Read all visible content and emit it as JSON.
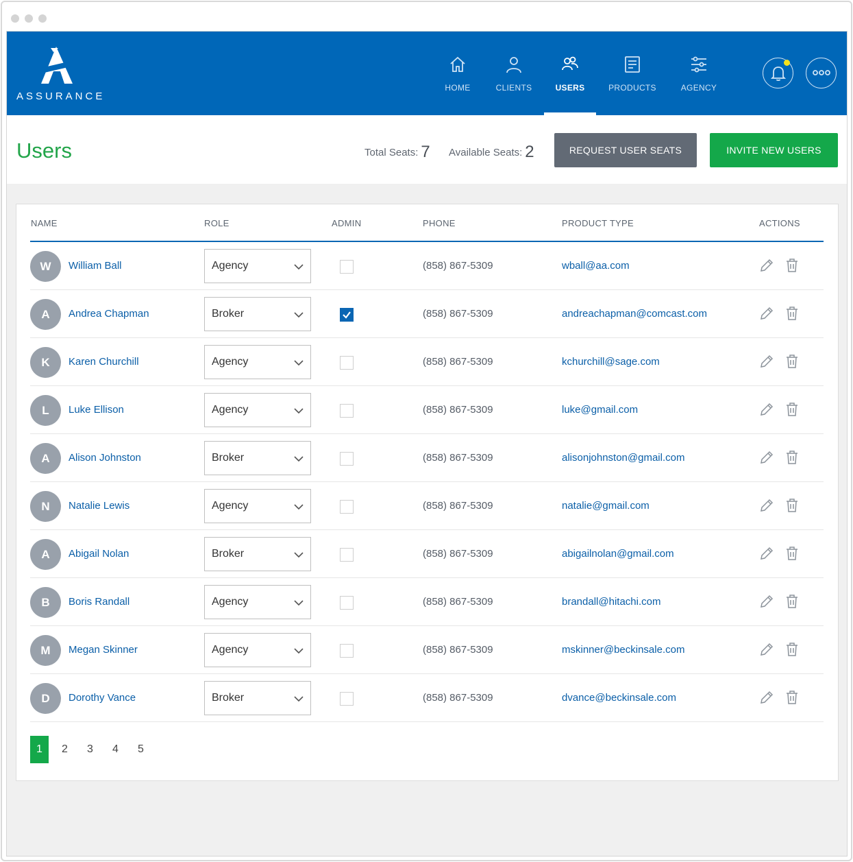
{
  "brand": {
    "name": "ASSURANCE"
  },
  "nav": [
    {
      "label": "HOME",
      "icon": "home-icon",
      "active": false
    },
    {
      "label": "CLIENTS",
      "icon": "user-icon",
      "active": false
    },
    {
      "label": "USERS",
      "icon": "users-icon",
      "active": true
    },
    {
      "label": "PRODUCTS",
      "icon": "document-icon",
      "active": false
    },
    {
      "label": "AGENCY",
      "icon": "sliders-icon",
      "active": false
    }
  ],
  "header_actions": {
    "notifications_icon": "bell-icon",
    "more_icon": "more-icon"
  },
  "page": {
    "title": "Users",
    "total_seats_label": "Total Seats:",
    "total_seats": "7",
    "available_seats_label": "Available Seats:",
    "available_seats": "2",
    "request_button": "REQUEST USER SEATS",
    "invite_button": "INVITE NEW USERS"
  },
  "table": {
    "columns": [
      "NAME",
      "ROLE",
      "ADMIN",
      "PHONE",
      "PRODUCT TYPE",
      "ACTIONS"
    ],
    "rows": [
      {
        "initial": "W",
        "name": "William Ball",
        "role": "Agency",
        "admin": false,
        "phone": "(858) 867-5309",
        "email": "wball@aa.com"
      },
      {
        "initial": "A",
        "name": "Andrea Chapman",
        "role": "Broker",
        "admin": true,
        "phone": "(858) 867-5309",
        "email": "andreachapman@comcast.com"
      },
      {
        "initial": "K",
        "name": "Karen Churchill",
        "role": "Agency",
        "admin": false,
        "phone": "(858) 867-5309",
        "email": "kchurchill@sage.com"
      },
      {
        "initial": "L",
        "name": "Luke Ellison",
        "role": "Agency",
        "admin": false,
        "phone": "(858) 867-5309",
        "email": "luke@gmail.com"
      },
      {
        "initial": "A",
        "name": "Alison Johnston",
        "role": "Broker",
        "admin": false,
        "phone": "(858) 867-5309",
        "email": "alisonjohnston@gmail.com"
      },
      {
        "initial": "N",
        "name": "Natalie Lewis",
        "role": "Agency",
        "admin": false,
        "phone": "(858) 867-5309",
        "email": "natalie@gmail.com"
      },
      {
        "initial": "A",
        "name": "Abigail  Nolan",
        "role": "Broker",
        "admin": false,
        "phone": "(858) 867-5309",
        "email": "abigailnolan@gmail.com"
      },
      {
        "initial": "B",
        "name": "Boris Randall",
        "role": "Agency",
        "admin": false,
        "phone": "(858) 867-5309",
        "email": "brandall@hitachi.com"
      },
      {
        "initial": "M",
        "name": "Megan Skinner",
        "role": "Agency",
        "admin": false,
        "phone": "(858) 867-5309",
        "email": "mskinner@beckinsale.com"
      },
      {
        "initial": "D",
        "name": "Dorothy Vance",
        "role": "Broker",
        "admin": false,
        "phone": "(858) 867-5309",
        "email": "dvance@beckinsale.com"
      }
    ]
  },
  "pagination": {
    "pages": [
      "1",
      "2",
      "3",
      "4",
      "5"
    ],
    "current": "1"
  },
  "colors": {
    "header": "#0067b8",
    "accent_green": "#14a84a",
    "link_blue": "#0b5fa8",
    "gray_button": "#626a75"
  }
}
